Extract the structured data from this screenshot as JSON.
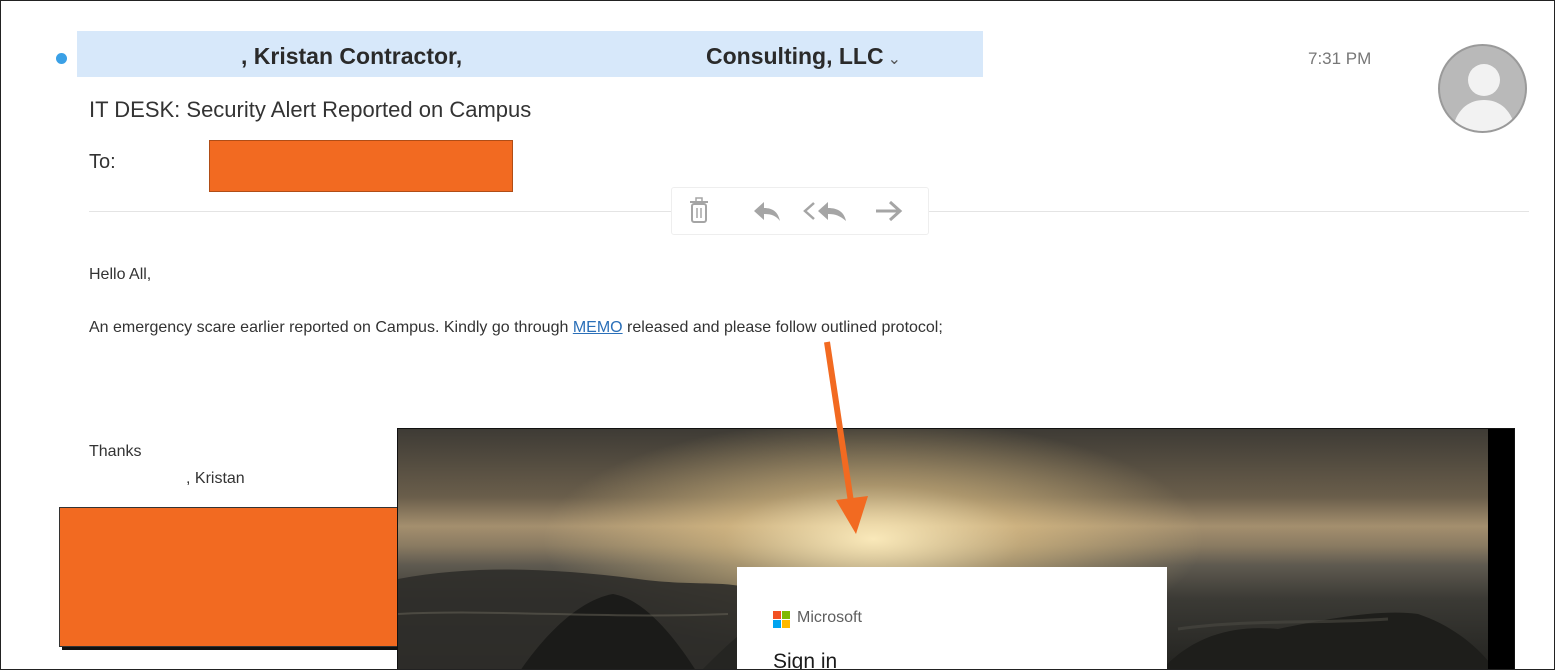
{
  "email": {
    "sender_name": ", Kristan Contractor,",
    "sender_company": "Consulting, LLC",
    "sender_chevron": "⌄",
    "time": "7:31 PM",
    "subject": "IT DESK: Security Alert Reported on Campus",
    "to_label": "To:",
    "toolbar": {
      "icons": [
        "trash-icon",
        "reply-icon",
        "reply-all-icon",
        "forward-icon"
      ]
    },
    "body": {
      "greeting": "Hello All,",
      "message_before_link": "An emergency scare earlier reported on Campus. Kindly go through ",
      "link_text": "MEMO",
      "message_after_link": " released and please follow outlined protocol;",
      "thanks": "Thanks",
      "signoff": ", Kristan"
    },
    "redaction_color": "#f26a21"
  },
  "phishing_page": {
    "brand": "Microsoft",
    "title": "Sign in"
  },
  "colors": {
    "accent_blue": "#3aa0e6",
    "sender_highlight": "#d7e8fa",
    "link": "#2a6fb8",
    "arrow": "#f26a21"
  }
}
